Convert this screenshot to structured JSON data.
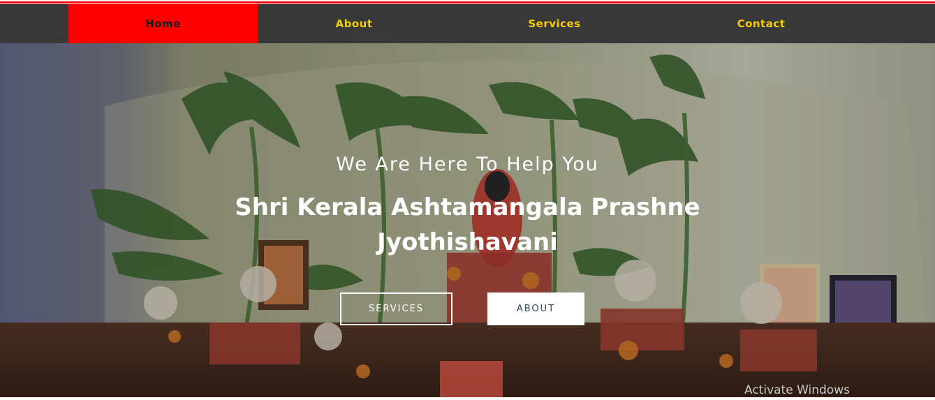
{
  "nav": {
    "items": [
      {
        "label": "Home",
        "active": true
      },
      {
        "label": "About",
        "active": false
      },
      {
        "label": "Services",
        "active": false
      },
      {
        "label": "Contact",
        "active": false
      }
    ]
  },
  "hero": {
    "subtitle": "We Are Here To Help You",
    "title_line1": "Shri Kerala Ashtamangala Prashne",
    "title_line2": "Jyothishavani",
    "buttons": {
      "services_label": "SERVICES",
      "about_label": "ABOUT"
    }
  },
  "os_overlay": {
    "watermark": "Activate Windows"
  },
  "colors": {
    "accent_red": "#ff0000",
    "nav_bg": "#383838",
    "nav_text": "#f5d000"
  }
}
